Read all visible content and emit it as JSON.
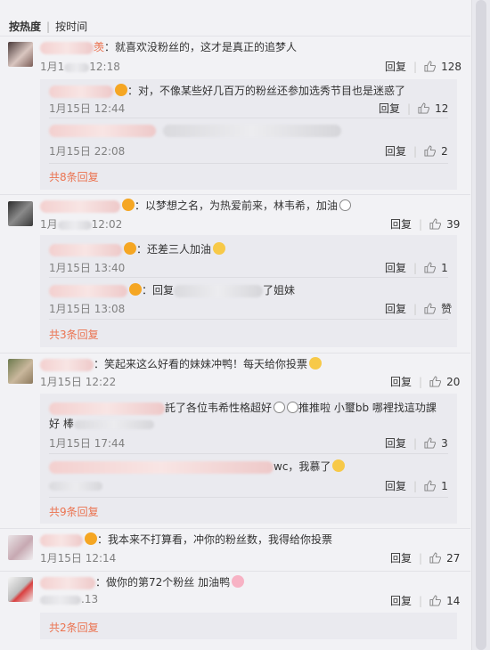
{
  "sort": {
    "hot": "按热度",
    "time": "按时间"
  },
  "labels": {
    "reply": "回复"
  },
  "comments": [
    {
      "name_tail": "羡",
      "text": "：就喜欢没粉丝的，这才是真正的追梦人",
      "time_tail": "12:18",
      "time_prefix": "1月1",
      "likes": "128",
      "replies": [
        {
          "text": "：对，不像某些好几百万的粉丝还参加选秀节目也是迷惑了",
          "time": "1月15日 12:44",
          "likes": "12"
        },
        {
          "text": "",
          "time": "1月15日 22:08",
          "likes": "2"
        }
      ],
      "more": "共8条回复"
    },
    {
      "name_tail": "",
      "text": "：以梦想之名，为热爱前来，林韦希，加油",
      "time_tail": "12:02",
      "time_prefix": "1月",
      "likes": "39",
      "replies": [
        {
          "text": "：还差三人加油",
          "time": "1月15日 13:40",
          "likes": "1"
        },
        {
          "text_prefix": "：回复",
          "text": "了姐妹",
          "time": "1月15日 13:08",
          "likes": "赞"
        }
      ],
      "more": "共3条回复"
    },
    {
      "name_tail": "",
      "text": "：笑起来这么好看的妹妹冲鸭！每天给你投票",
      "time": "1月15日 12:22",
      "likes": "20",
      "replies": [
        {
          "text": "託了各位韦希性格超好",
          "text2": "推推啦 小璽bb 哪裡找這功課",
          "text3": "好 棒",
          "time": "1月15日 17:44",
          "likes": "3"
        },
        {
          "text": "wc，我慕了",
          "time": "",
          "likes": "1"
        }
      ],
      "more": "共9条回复"
    },
    {
      "name_tail": "",
      "text": "：我本来不打算看，冲你的粉丝数，我得给你投票",
      "time": "1月15日 12:14",
      "likes": "27",
      "replies": [],
      "more": ""
    },
    {
      "name_tail": "",
      "text": "：做你的第72个粉丝 加油鸭",
      "time_tail": ".13",
      "likes": "14",
      "replies": [],
      "more": "共2条回复"
    }
  ],
  "colors": {
    "accent": "#eb7350",
    "background": "#f2f2f5",
    "reply_bg": "#eaeaef"
  }
}
